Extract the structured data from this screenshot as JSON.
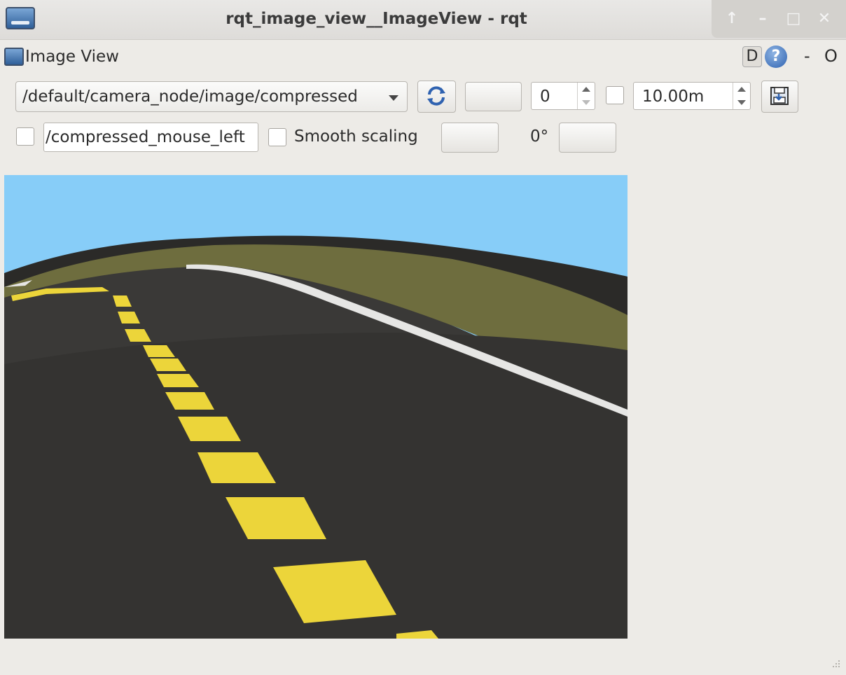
{
  "window": {
    "title": "rqt_image_view__ImageView - rqt"
  },
  "plugin": {
    "title": "Image View",
    "d_label": "D",
    "help_label": "?",
    "minimize_label": "-",
    "close_label": "O"
  },
  "toolbar": {
    "topic": "/default/camera_node/image/compressed",
    "num_value": "0",
    "timeout_value": "10.00m",
    "mouse_topic": "/compressed_mouse_left",
    "smooth_scaling_label": "Smooth scaling",
    "rotation_label": "0°"
  },
  "image": {
    "description_colors": {
      "sky": "#87cdf8",
      "road": "#3a3937",
      "grass": "#6e6d3e",
      "lane_marking": "#ecd53a",
      "edge_line": "#e6e6e4"
    }
  }
}
